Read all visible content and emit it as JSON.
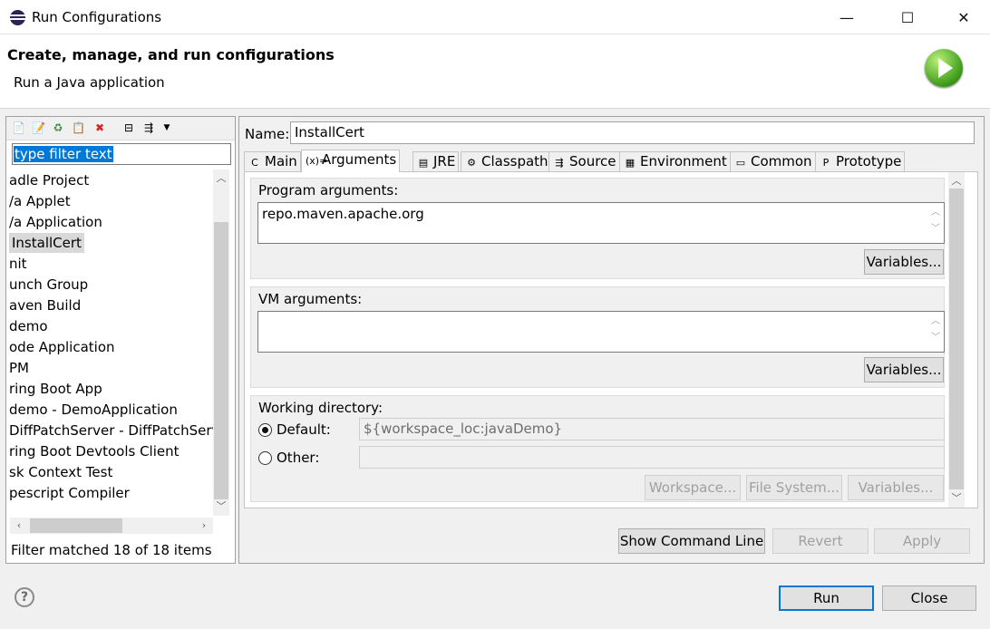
{
  "window": {
    "title": "Run Configurations",
    "minimize": "—",
    "maximize": "☐",
    "close": "✕"
  },
  "header": {
    "title": "Create, manage, and run configurations",
    "subtitle": "Run a Java application"
  },
  "left": {
    "filter_text": "type filter text",
    "items": [
      "adle Project",
      "/a Applet",
      "/a Application",
      "InstallCert",
      "nit",
      "unch Group",
      "aven Build",
      " demo",
      "ode Application",
      "PM",
      "ring Boot App",
      " demo - DemoApplication",
      " DiffPatchServer - DiffPatchServ",
      "ring Boot Devtools Client",
      "sk Context Test",
      "pescript Compiler"
    ],
    "selected_index": 3,
    "status": "Filter matched 18 of 18 items"
  },
  "config": {
    "name_label": "Name:",
    "name_value": "InstallCert",
    "tabs": [
      {
        "label": "Main",
        "icon": "C"
      },
      {
        "label": "Arguments",
        "icon": "(x)="
      },
      {
        "label": "JRE",
        "icon": "▤"
      },
      {
        "label": "Classpath",
        "icon": "⚙"
      },
      {
        "label": "Source",
        "icon": "⇶"
      },
      {
        "label": "Environment",
        "icon": "▦"
      },
      {
        "label": "Common",
        "icon": "▭"
      },
      {
        "label": "Prototype",
        "icon": "P"
      }
    ],
    "active_tab": "Arguments",
    "program_args_label": "Program arguments:",
    "program_args_value": "repo.maven.apache.org",
    "vm_args_label": "VM arguments:",
    "vm_args_value": "",
    "variables_label": "Variables...",
    "working_dir_label": "Working directory:",
    "default_label": "Default:",
    "default_value": "${workspace_loc:javaDemo}",
    "other_label": "Other:",
    "other_value": "",
    "workspace_btn": "Workspace...",
    "filesystem_btn": "File System...",
    "wd_variables_btn": "Variables..."
  },
  "actions": {
    "show_cmd": "Show Command Line",
    "revert": "Revert",
    "apply": "Apply",
    "run": "Run",
    "close": "Close",
    "help": "?"
  }
}
